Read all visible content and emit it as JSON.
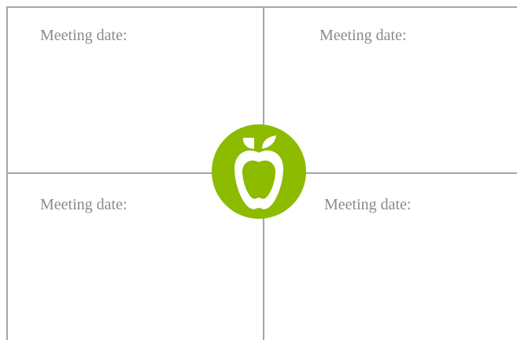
{
  "quadrants": {
    "top_left": {
      "label": "Meeting date:"
    },
    "top_right": {
      "label": "Meeting date:"
    },
    "bottom_left": {
      "label": "Meeting date:"
    },
    "bottom_right": {
      "label": "Meeting date:"
    }
  },
  "logo": {
    "icon": "apple-icon",
    "circle_color": "#8cbb00",
    "symbol_color": "#ffffff"
  },
  "colors": {
    "grid_lines": "#a6a6a6",
    "label_text": "#8a8a8a",
    "background": "#ffffff"
  }
}
